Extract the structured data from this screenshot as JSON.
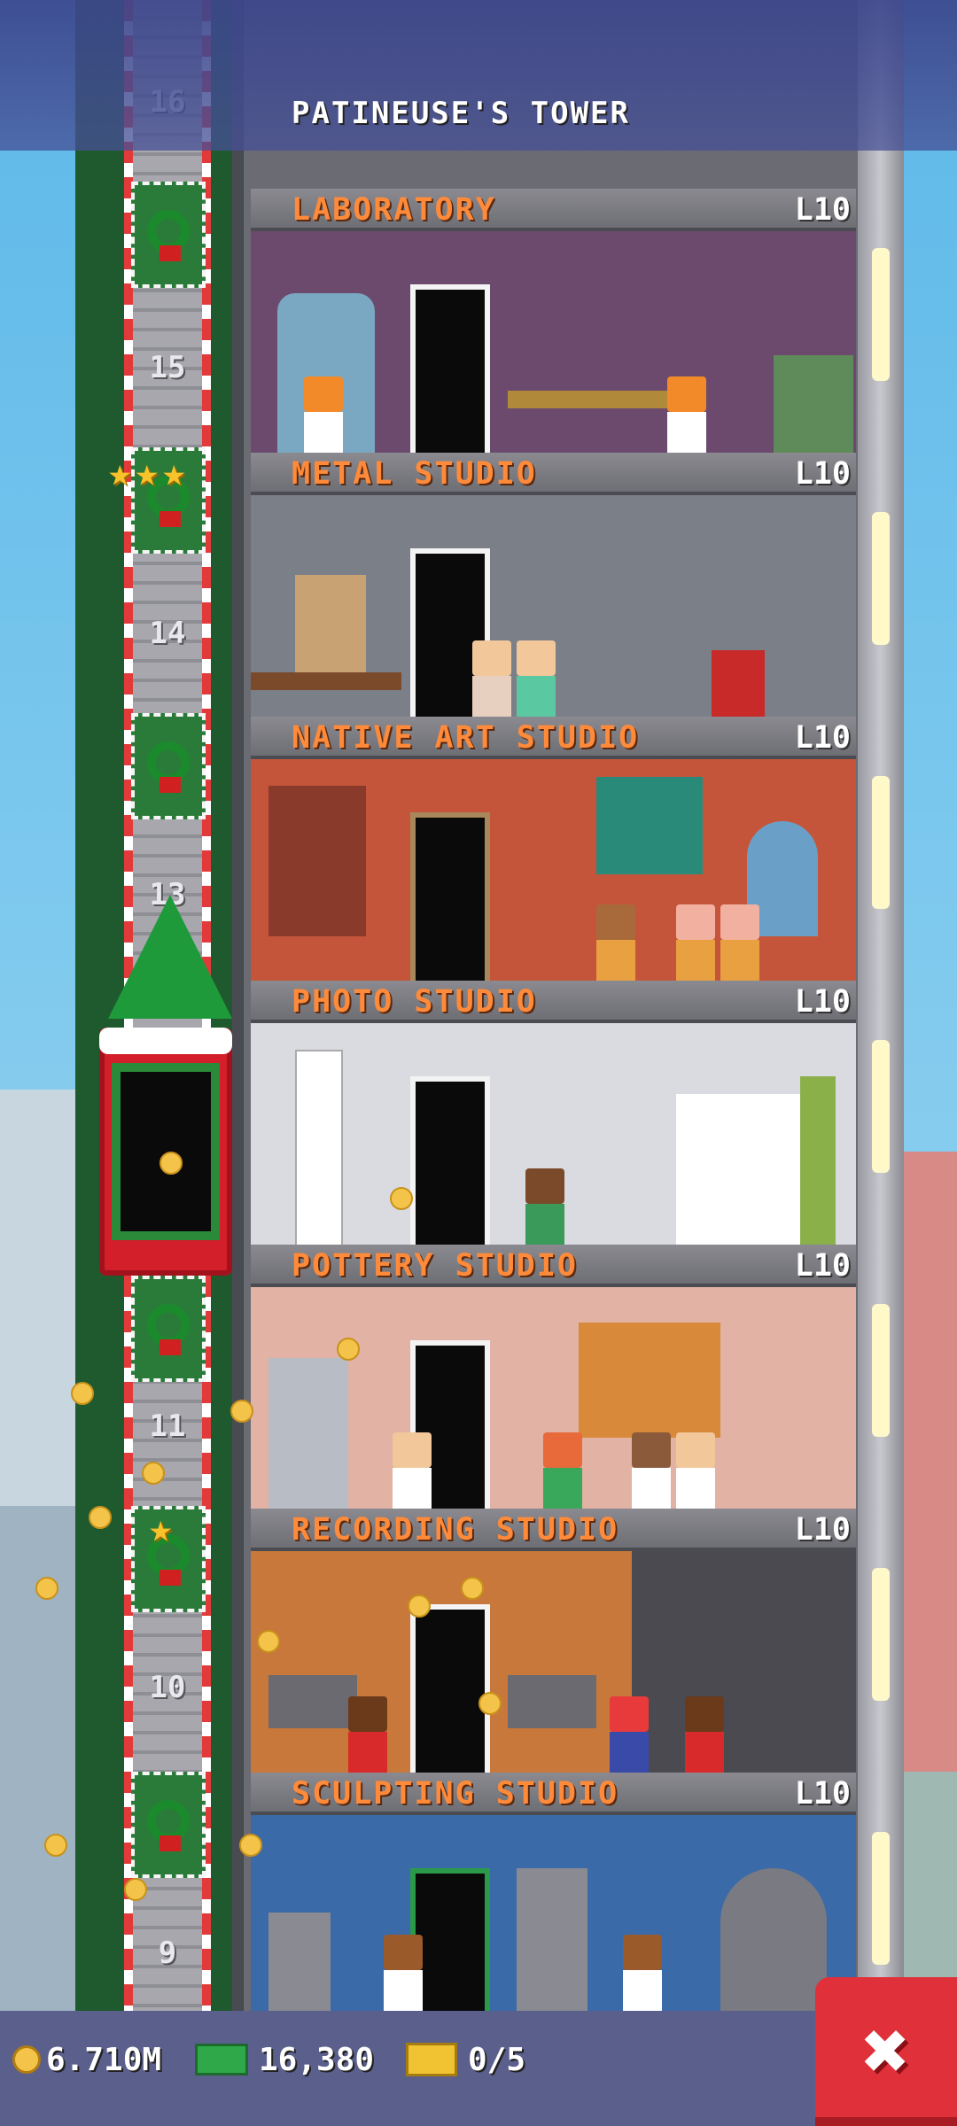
{
  "header": {
    "title": "PATINEUSE'S TOWER"
  },
  "floors": [
    {
      "name": "LABORATORY",
      "level": "L10",
      "color": "#6b4a6e"
    },
    {
      "name": "METAL STUDIO",
      "level": "L10",
      "color": "#7b8088"
    },
    {
      "name": "NATIVE ART STUDIO",
      "level": "L10",
      "color": "#c4553a"
    },
    {
      "name": "PHOTO STUDIO",
      "level": "L10",
      "color": "#d9dbe0"
    },
    {
      "name": "POTTERY STUDIO",
      "level": "L10",
      "color": "#e2b2a4"
    },
    {
      "name": "RECORDING STUDIO",
      "level": "L10",
      "color": "#c8783a"
    },
    {
      "name": "SCULPTING STUDIO",
      "level": "L10",
      "color": "#3a6aa8"
    }
  ],
  "elevator": {
    "floor_numbers": [
      "16",
      "15",
      "14",
      "13",
      "11",
      "10",
      "9"
    ]
  },
  "bottom_bar": {
    "coins": "6.710M",
    "bux": "16,380",
    "tickets": "0/5"
  },
  "icons": {
    "coin": "coin-icon",
    "bux": "bux-icon",
    "ticket": "ticket-icon",
    "close": "close-icon",
    "star": "star-icon"
  },
  "colors": {
    "header": "#3c468c",
    "bottom_bar": "#5a5f8c",
    "close_button": "#e0303a",
    "floor_label_text": "#ff8a3a"
  }
}
